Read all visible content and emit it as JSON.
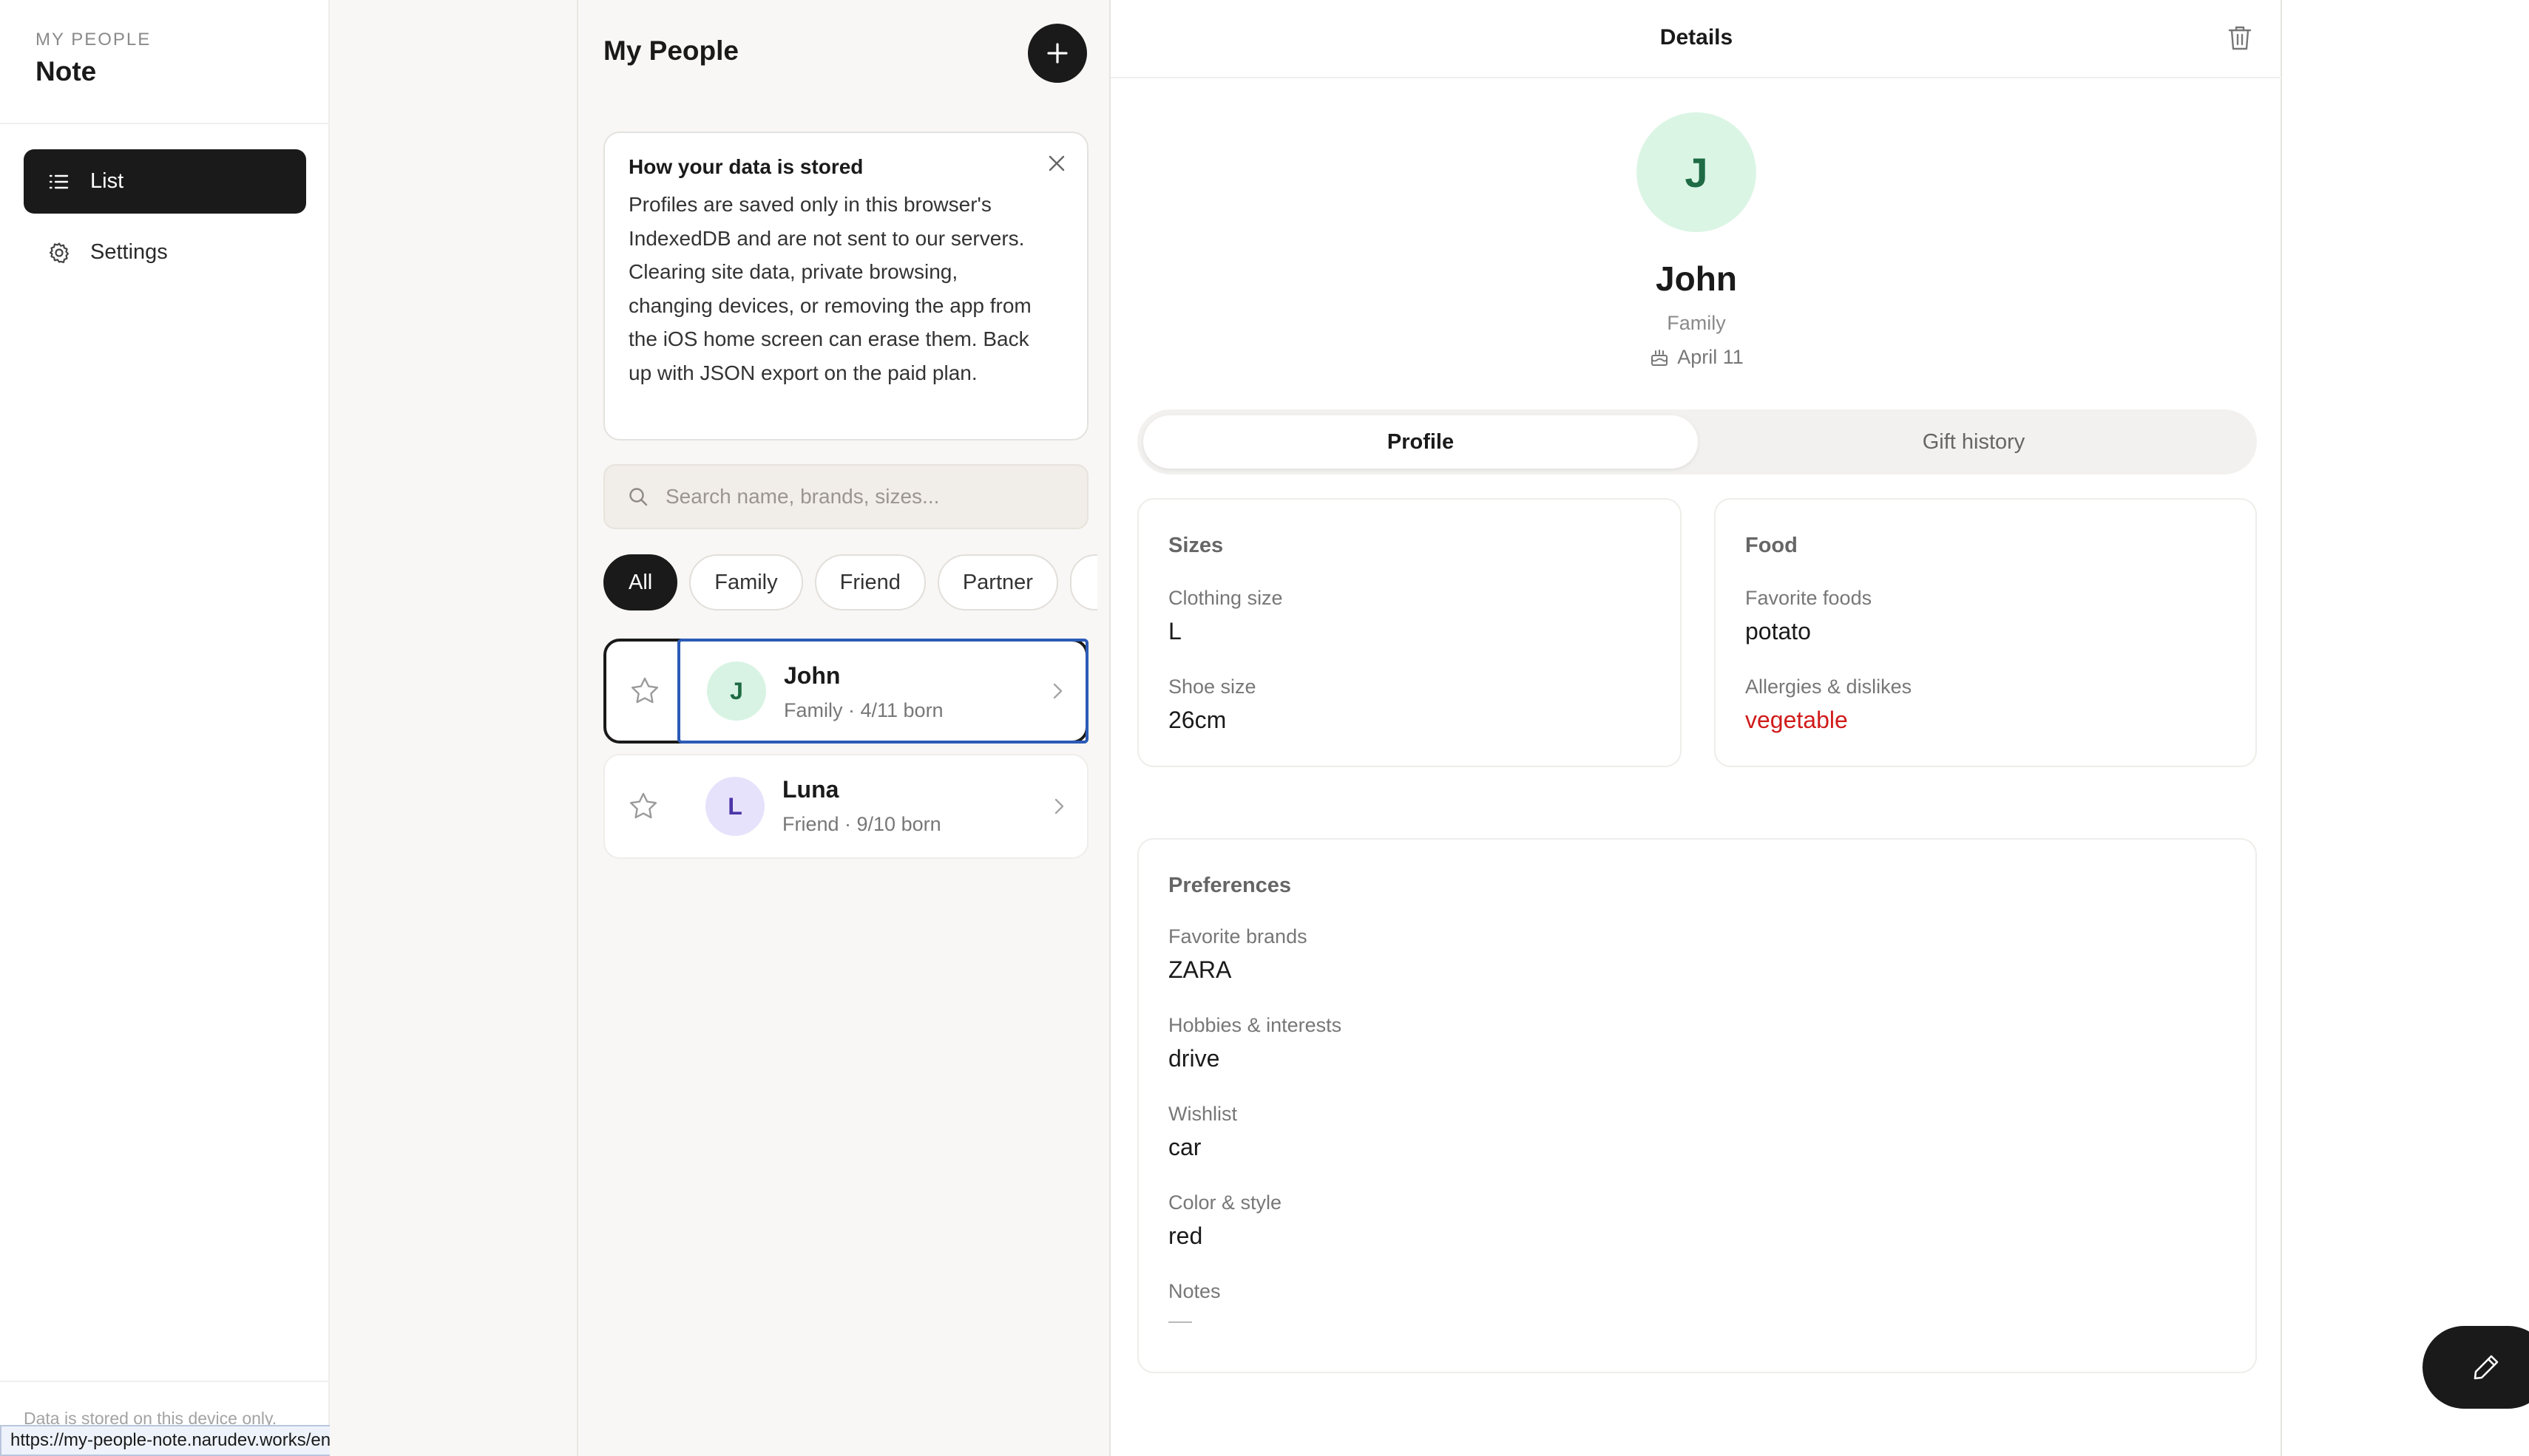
{
  "sidebar": {
    "brand_sub": "MY PEOPLE",
    "brand_title": "Note",
    "items": [
      {
        "label": "List",
        "icon": "list-icon",
        "active": true
      },
      {
        "label": "Settings",
        "icon": "gear-icon",
        "active": false
      }
    ],
    "footer": "Data is stored on this device only."
  },
  "status_url": "https://my-people-note.narudev.works/en/app",
  "list": {
    "title": "My People",
    "add_icon": "plus-icon",
    "info": {
      "title": "How your data is stored",
      "body": "Profiles are saved only in this browser's IndexedDB and are not sent to our servers. Clearing site data, private browsing, changing devices, or removing the app from the iOS home screen can erase them. Back up with JSON export on the paid plan."
    },
    "search_placeholder": "Search name, brands, sizes...",
    "filters": [
      "All",
      "Family",
      "Friend",
      "Partner",
      ""
    ],
    "active_filter": "All",
    "people": [
      {
        "initial": "J",
        "name": "John",
        "meta": "Family · 4/11 born",
        "selected": true
      },
      {
        "initial": "L",
        "name": "Luna",
        "meta": "Friend · 9/10 born",
        "selected": false
      }
    ]
  },
  "details": {
    "title": "Details",
    "initial": "J",
    "name": "John",
    "group": "Family",
    "birthday": "April 11",
    "tabs": [
      "Profile",
      "Gift history"
    ],
    "active_tab": "Profile",
    "sizes": {
      "title": "Sizes",
      "clothing_label": "Clothing size",
      "clothing_value": "L",
      "shoe_label": "Shoe size",
      "shoe_value": "26cm"
    },
    "food": {
      "title": "Food",
      "favorite_label": "Favorite foods",
      "favorite_value": "potato",
      "allergies_label": "Allergies & dislikes",
      "allergies_value": "vegetable"
    },
    "preferences": {
      "title": "Preferences",
      "brands_label": "Favorite brands",
      "brands_value": "ZARA",
      "hobbies_label": "Hobbies & interests",
      "hobbies_value": "drive",
      "wishlist_label": "Wishlist",
      "wishlist_value": "car",
      "color_label": "Color & style",
      "color_value": "red",
      "notes_label": "Notes",
      "notes_value": "—"
    }
  },
  "colors": {
    "primary": "#1a1a1a",
    "panel_bg": "#f8f7f5",
    "allergy_red": "#d11a1a",
    "avatar_green": "#dbf5e5",
    "avatar_purple": "#e7e2fb",
    "focus_blue": "#2b5bb6"
  }
}
